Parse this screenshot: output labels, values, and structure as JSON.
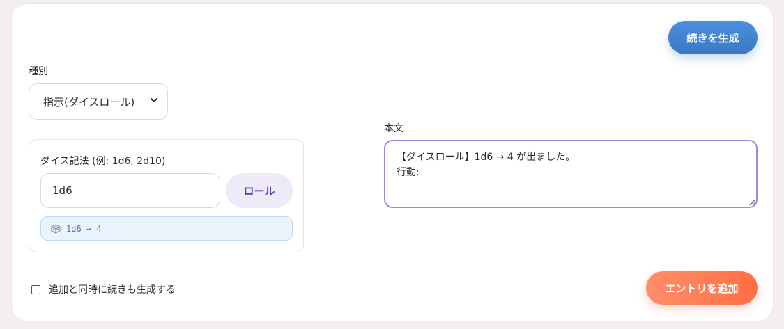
{
  "header": {
    "generate_button": "続きを生成"
  },
  "type": {
    "label": "種別",
    "selected": "指示(ダイスロール)",
    "chevron_icon": "chevron-down-icon"
  },
  "dice": {
    "label": "ダイス記法 (例: 1d6, 2d10)",
    "input_value": "1d6",
    "roll_button": "ロール",
    "result_icon": "dice-icon",
    "result_text": "1d6 → 4"
  },
  "body": {
    "label": "本文",
    "text": "【ダイスロール】1d6 → 4 が出ました。\n行動:"
  },
  "options": {
    "checkbox_label": "追加と同時に続きも生成する",
    "checked": false
  },
  "footer": {
    "add_button": "エントリを追加"
  },
  "colors": {
    "generate": "#3a78c4",
    "add": "#ff6e44",
    "roll_text": "#5a3fb0",
    "focus_border": "#9f86e6"
  }
}
